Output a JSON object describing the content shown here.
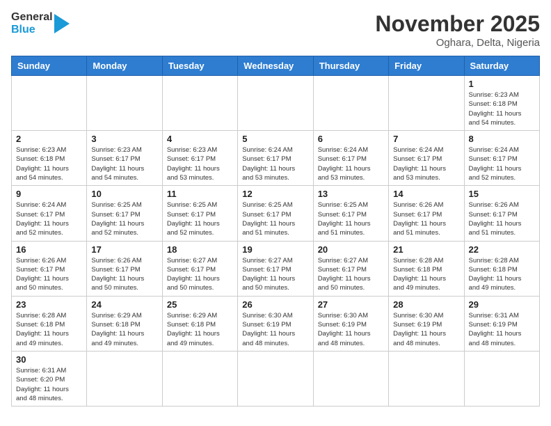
{
  "header": {
    "logo_general": "General",
    "logo_blue": "Blue",
    "month_title": "November 2025",
    "location": "Oghara, Delta, Nigeria"
  },
  "weekdays": [
    "Sunday",
    "Monday",
    "Tuesday",
    "Wednesday",
    "Thursday",
    "Friday",
    "Saturday"
  ],
  "weeks": [
    [
      {
        "day": "",
        "info": ""
      },
      {
        "day": "",
        "info": ""
      },
      {
        "day": "",
        "info": ""
      },
      {
        "day": "",
        "info": ""
      },
      {
        "day": "",
        "info": ""
      },
      {
        "day": "",
        "info": ""
      },
      {
        "day": "1",
        "info": "Sunrise: 6:23 AM\nSunset: 6:18 PM\nDaylight: 11 hours\nand 54 minutes."
      }
    ],
    [
      {
        "day": "2",
        "info": "Sunrise: 6:23 AM\nSunset: 6:18 PM\nDaylight: 11 hours\nand 54 minutes."
      },
      {
        "day": "3",
        "info": "Sunrise: 6:23 AM\nSunset: 6:17 PM\nDaylight: 11 hours\nand 54 minutes."
      },
      {
        "day": "4",
        "info": "Sunrise: 6:23 AM\nSunset: 6:17 PM\nDaylight: 11 hours\nand 53 minutes."
      },
      {
        "day": "5",
        "info": "Sunrise: 6:24 AM\nSunset: 6:17 PM\nDaylight: 11 hours\nand 53 minutes."
      },
      {
        "day": "6",
        "info": "Sunrise: 6:24 AM\nSunset: 6:17 PM\nDaylight: 11 hours\nand 53 minutes."
      },
      {
        "day": "7",
        "info": "Sunrise: 6:24 AM\nSunset: 6:17 PM\nDaylight: 11 hours\nand 53 minutes."
      },
      {
        "day": "8",
        "info": "Sunrise: 6:24 AM\nSunset: 6:17 PM\nDaylight: 11 hours\nand 52 minutes."
      }
    ],
    [
      {
        "day": "9",
        "info": "Sunrise: 6:24 AM\nSunset: 6:17 PM\nDaylight: 11 hours\nand 52 minutes."
      },
      {
        "day": "10",
        "info": "Sunrise: 6:25 AM\nSunset: 6:17 PM\nDaylight: 11 hours\nand 52 minutes."
      },
      {
        "day": "11",
        "info": "Sunrise: 6:25 AM\nSunset: 6:17 PM\nDaylight: 11 hours\nand 52 minutes."
      },
      {
        "day": "12",
        "info": "Sunrise: 6:25 AM\nSunset: 6:17 PM\nDaylight: 11 hours\nand 51 minutes."
      },
      {
        "day": "13",
        "info": "Sunrise: 6:25 AM\nSunset: 6:17 PM\nDaylight: 11 hours\nand 51 minutes."
      },
      {
        "day": "14",
        "info": "Sunrise: 6:26 AM\nSunset: 6:17 PM\nDaylight: 11 hours\nand 51 minutes."
      },
      {
        "day": "15",
        "info": "Sunrise: 6:26 AM\nSunset: 6:17 PM\nDaylight: 11 hours\nand 51 minutes."
      }
    ],
    [
      {
        "day": "16",
        "info": "Sunrise: 6:26 AM\nSunset: 6:17 PM\nDaylight: 11 hours\nand 50 minutes."
      },
      {
        "day": "17",
        "info": "Sunrise: 6:26 AM\nSunset: 6:17 PM\nDaylight: 11 hours\nand 50 minutes."
      },
      {
        "day": "18",
        "info": "Sunrise: 6:27 AM\nSunset: 6:17 PM\nDaylight: 11 hours\nand 50 minutes."
      },
      {
        "day": "19",
        "info": "Sunrise: 6:27 AM\nSunset: 6:17 PM\nDaylight: 11 hours\nand 50 minutes."
      },
      {
        "day": "20",
        "info": "Sunrise: 6:27 AM\nSunset: 6:17 PM\nDaylight: 11 hours\nand 50 minutes."
      },
      {
        "day": "21",
        "info": "Sunrise: 6:28 AM\nSunset: 6:18 PM\nDaylight: 11 hours\nand 49 minutes."
      },
      {
        "day": "22",
        "info": "Sunrise: 6:28 AM\nSunset: 6:18 PM\nDaylight: 11 hours\nand 49 minutes."
      }
    ],
    [
      {
        "day": "23",
        "info": "Sunrise: 6:28 AM\nSunset: 6:18 PM\nDaylight: 11 hours\nand 49 minutes."
      },
      {
        "day": "24",
        "info": "Sunrise: 6:29 AM\nSunset: 6:18 PM\nDaylight: 11 hours\nand 49 minutes."
      },
      {
        "day": "25",
        "info": "Sunrise: 6:29 AM\nSunset: 6:18 PM\nDaylight: 11 hours\nand 49 minutes."
      },
      {
        "day": "26",
        "info": "Sunrise: 6:30 AM\nSunset: 6:19 PM\nDaylight: 11 hours\nand 48 minutes."
      },
      {
        "day": "27",
        "info": "Sunrise: 6:30 AM\nSunset: 6:19 PM\nDaylight: 11 hours\nand 48 minutes."
      },
      {
        "day": "28",
        "info": "Sunrise: 6:30 AM\nSunset: 6:19 PM\nDaylight: 11 hours\nand 48 minutes."
      },
      {
        "day": "29",
        "info": "Sunrise: 6:31 AM\nSunset: 6:19 PM\nDaylight: 11 hours\nand 48 minutes."
      }
    ],
    [
      {
        "day": "30",
        "info": "Sunrise: 6:31 AM\nSunset: 6:20 PM\nDaylight: 11 hours\nand 48 minutes."
      },
      {
        "day": "",
        "info": ""
      },
      {
        "day": "",
        "info": ""
      },
      {
        "day": "",
        "info": ""
      },
      {
        "day": "",
        "info": ""
      },
      {
        "day": "",
        "info": ""
      },
      {
        "day": "",
        "info": ""
      }
    ]
  ]
}
